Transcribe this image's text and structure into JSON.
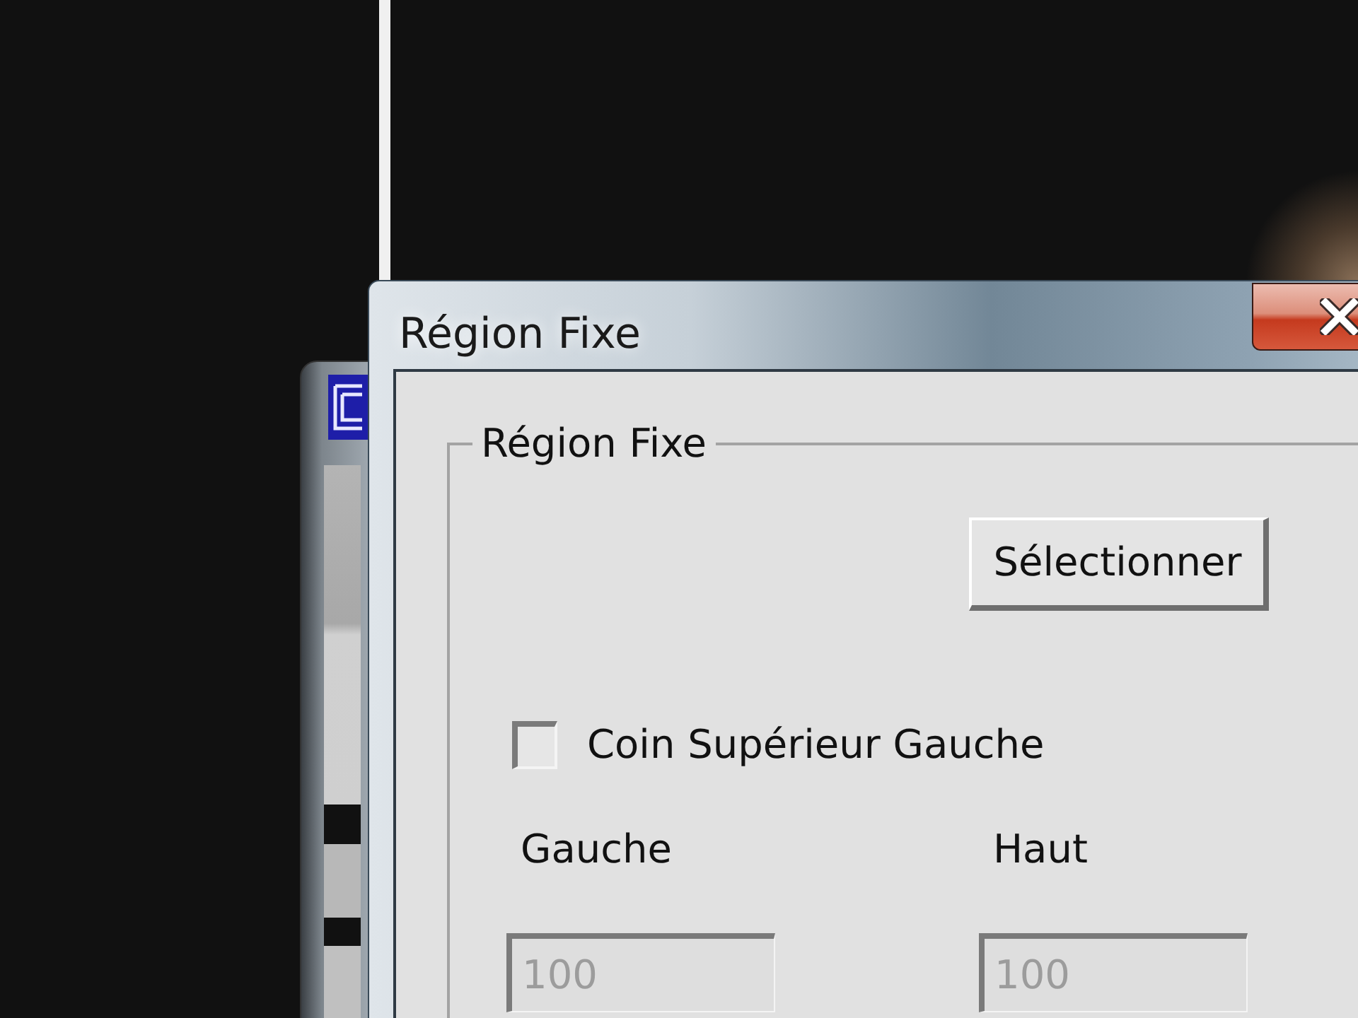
{
  "window": {
    "title": "Région Fixe"
  },
  "group": {
    "label": "Région Fixe",
    "select_button": "Sélectionner",
    "checkbox": {
      "label": "Coin Supérieur Gauche",
      "checked": false
    },
    "fields": [
      {
        "label": "Gauche",
        "value": "100",
        "disabled": true
      },
      {
        "label": "Haut",
        "value": "100",
        "disabled": true
      }
    ]
  }
}
